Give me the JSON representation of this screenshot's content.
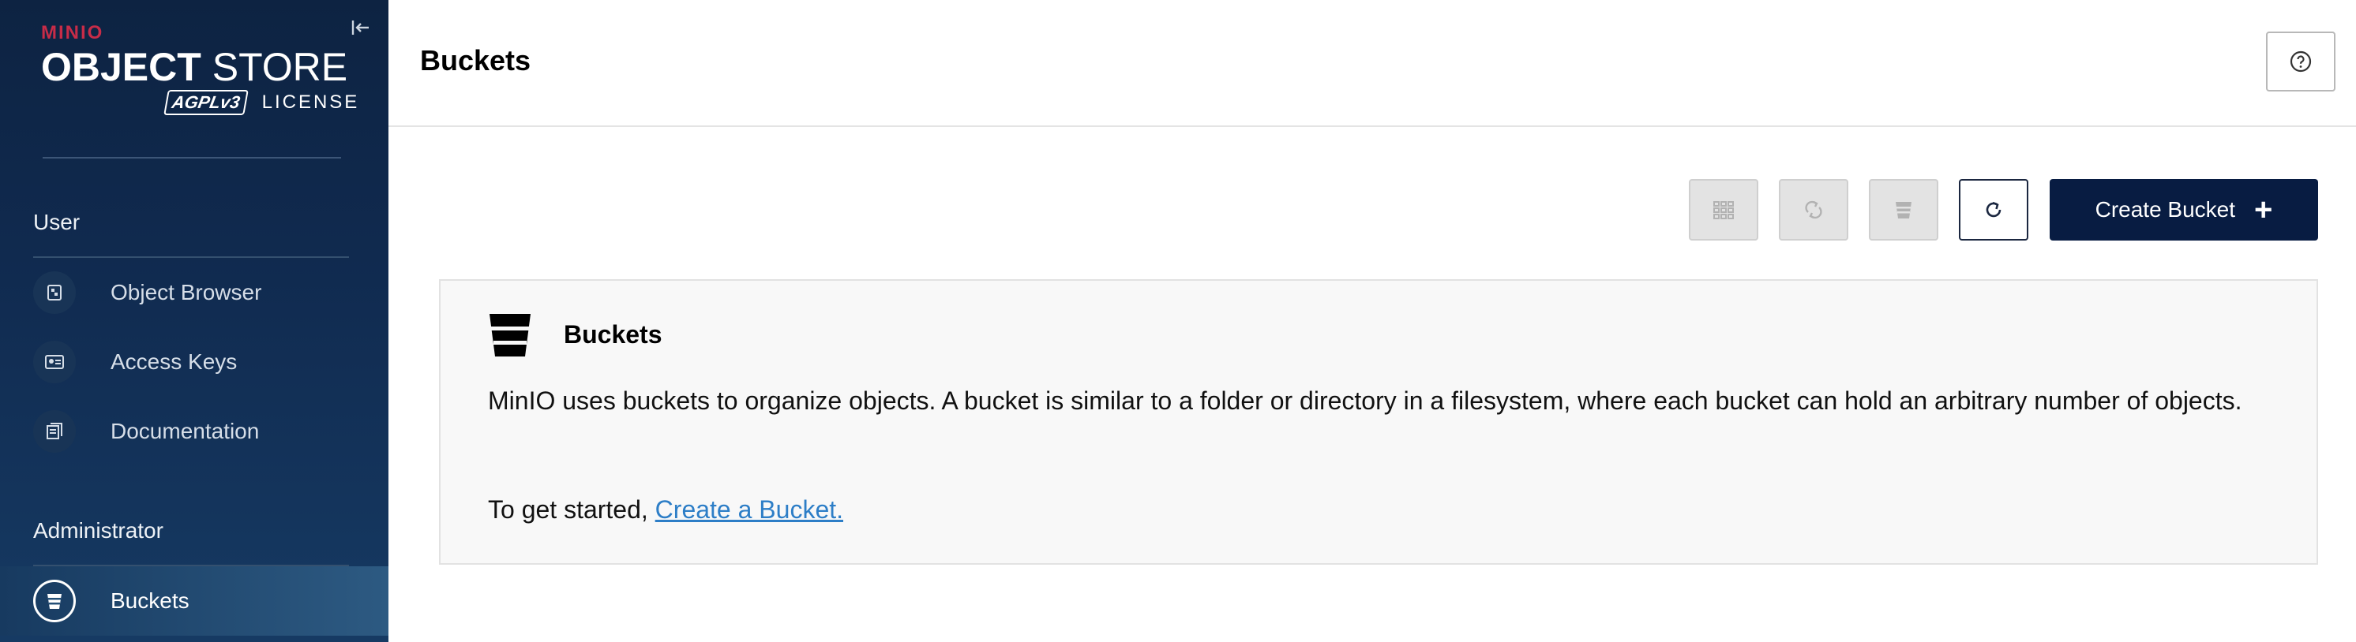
{
  "app": {
    "logo": {
      "brand": "MINIO",
      "product_bold": "OBJECT",
      "product_light": "STORE",
      "badge": "AGPLv3",
      "license": "LICENSE"
    }
  },
  "sidebar": {
    "sections": [
      {
        "title": "User",
        "items": [
          {
            "label": "Object Browser",
            "icon": "object-browser-icon"
          },
          {
            "label": "Access Keys",
            "icon": "access-keys-icon"
          },
          {
            "label": "Documentation",
            "icon": "documentation-icon"
          }
        ]
      },
      {
        "title": "Administrator",
        "items": [
          {
            "label": "Buckets",
            "icon": "bucket-icon",
            "active": true
          }
        ]
      }
    ]
  },
  "header": {
    "title": "Buckets",
    "help_icon": "help-icon"
  },
  "toolbar": {
    "icons": [
      "grid-view-icon",
      "replication-icon",
      "lifecycle-icon",
      "refresh-icon"
    ],
    "create_label": "Create Bucket",
    "create_icon": "plus-icon"
  },
  "card": {
    "title": "Buckets",
    "description": "MinIO uses buckets to organize objects. A bucket is similar to a folder or directory in a filesystem, where each bucket can hold an arbitrary number of objects.",
    "start_prefix": "To get started,",
    "start_link": "Create a Bucket."
  },
  "colors": {
    "sidebar_bg": "#0d2342",
    "accent_dark": "#081c42",
    "brand_red": "#c72c48",
    "link": "#2d7ec7"
  }
}
